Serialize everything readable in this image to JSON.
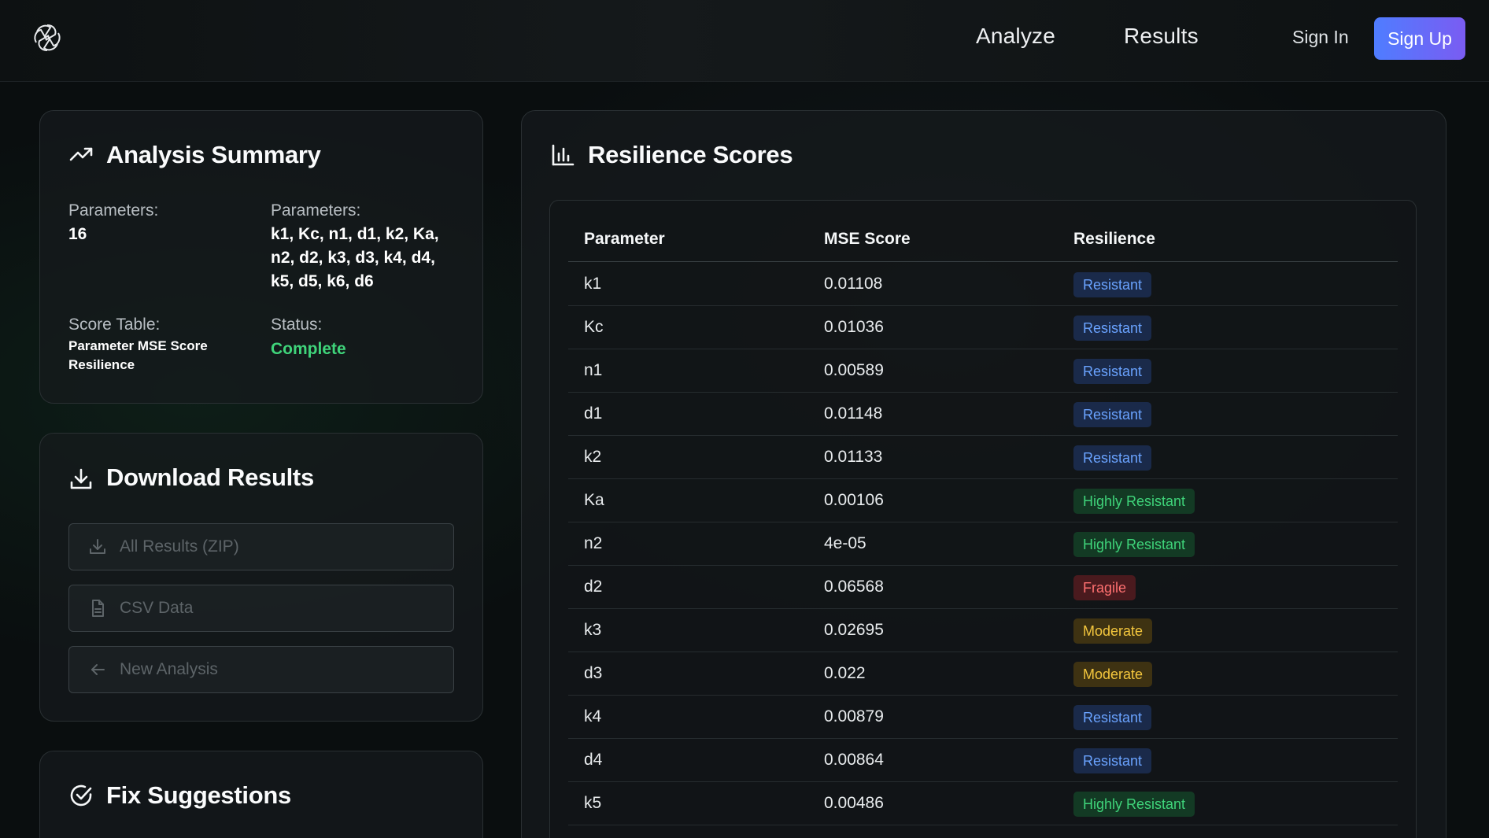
{
  "nav": {
    "analyze": "Analyze",
    "results": "Results",
    "sign_in": "Sign In",
    "sign_up": "Sign Up"
  },
  "summary": {
    "title": "Analysis Summary",
    "params_count_label": "Parameters:",
    "params_count": "16",
    "params_list_label": "Parameters:",
    "params_list_lines": [
      "k1, Kc, n1, d1, k2, Ka,",
      "n2, d2, k3, d3, k4, d4,",
      "k5, d5, k6, d6"
    ],
    "score_table_label": "Score Table:",
    "score_table_lines": [
      "Parameter MSE Score",
      "Resilience"
    ],
    "status_label": "Status:",
    "status_value": "Complete"
  },
  "download": {
    "title": "Download Results",
    "buttons": [
      "All Results (ZIP)",
      "CSV Data",
      "New Analysis"
    ]
  },
  "fix": {
    "title": "Fix Suggestions"
  },
  "scores": {
    "title": "Resilience Scores",
    "columns": [
      "Parameter",
      "MSE Score",
      "Resilience"
    ],
    "rows": [
      {
        "param": "k1",
        "mse": "0.01108",
        "resilience": "Resistant"
      },
      {
        "param": "Kc",
        "mse": "0.01036",
        "resilience": "Resistant"
      },
      {
        "param": "n1",
        "mse": "0.00589",
        "resilience": "Resistant"
      },
      {
        "param": "d1",
        "mse": "0.01148",
        "resilience": "Resistant"
      },
      {
        "param": "k2",
        "mse": "0.01133",
        "resilience": "Resistant"
      },
      {
        "param": "Ka",
        "mse": "0.00106",
        "resilience": "Highly Resistant"
      },
      {
        "param": "n2",
        "mse": "4e-05",
        "resilience": "Highly Resistant"
      },
      {
        "param": "d2",
        "mse": "0.06568",
        "resilience": "Fragile"
      },
      {
        "param": "k3",
        "mse": "0.02695",
        "resilience": "Moderate"
      },
      {
        "param": "d3",
        "mse": "0.022",
        "resilience": "Moderate"
      },
      {
        "param": "k4",
        "mse": "0.00879",
        "resilience": "Resistant"
      },
      {
        "param": "d4",
        "mse": "0.00864",
        "resilience": "Resistant"
      },
      {
        "param": "k5",
        "mse": "0.00486",
        "resilience": "Highly Resistant"
      }
    ]
  },
  "colors": {
    "accent_gradient_start": "#4f7dff",
    "accent_gradient_end": "#7a5cf2",
    "status_complete": "#3fd47a",
    "resistant": "#6aa3ff",
    "highly_resistant": "#3fd47a",
    "fragile": "#ff7070",
    "moderate": "#f3c63d"
  }
}
